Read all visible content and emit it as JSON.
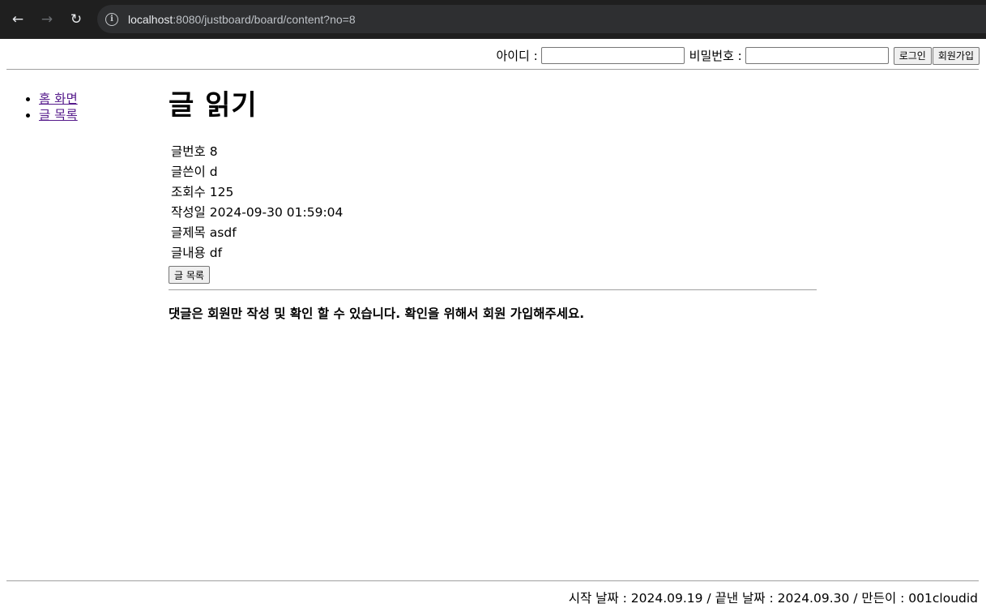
{
  "browser": {
    "back_icon": "←",
    "forward_icon": "→",
    "reload_icon": "↻",
    "url_host": "localhost",
    "url_rest": ":8080/justboard/board/content?no=8"
  },
  "login": {
    "id_label": "아이디 :",
    "pw_label": "비밀번호 :",
    "login_button": "로그인",
    "signup_button": "회원가입"
  },
  "nav": {
    "items": [
      {
        "label": "홈 화면"
      },
      {
        "label": "글 목록"
      }
    ]
  },
  "post": {
    "title": "글 읽기",
    "fields": [
      {
        "label": "글번호",
        "value": "8"
      },
      {
        "label": "글쓴이",
        "value": "d"
      },
      {
        "label": "조회수",
        "value": "125"
      },
      {
        "label": "작성일",
        "value": "2024-09-30 01:59:04"
      },
      {
        "label": "글제목",
        "value": "asdf"
      },
      {
        "label": "글내용",
        "value": "df"
      }
    ],
    "list_button": "글 목록",
    "comment_notice": "댓글은 회원만 작성 및 확인 할 수 있습니다. 확인을 위해서 회원 가입해주세요."
  },
  "footer": {
    "text": "시작 날짜 : 2024.09.19 / 끝낸 날짜 : 2024.09.30 / 만든이 : 001cloudid"
  }
}
